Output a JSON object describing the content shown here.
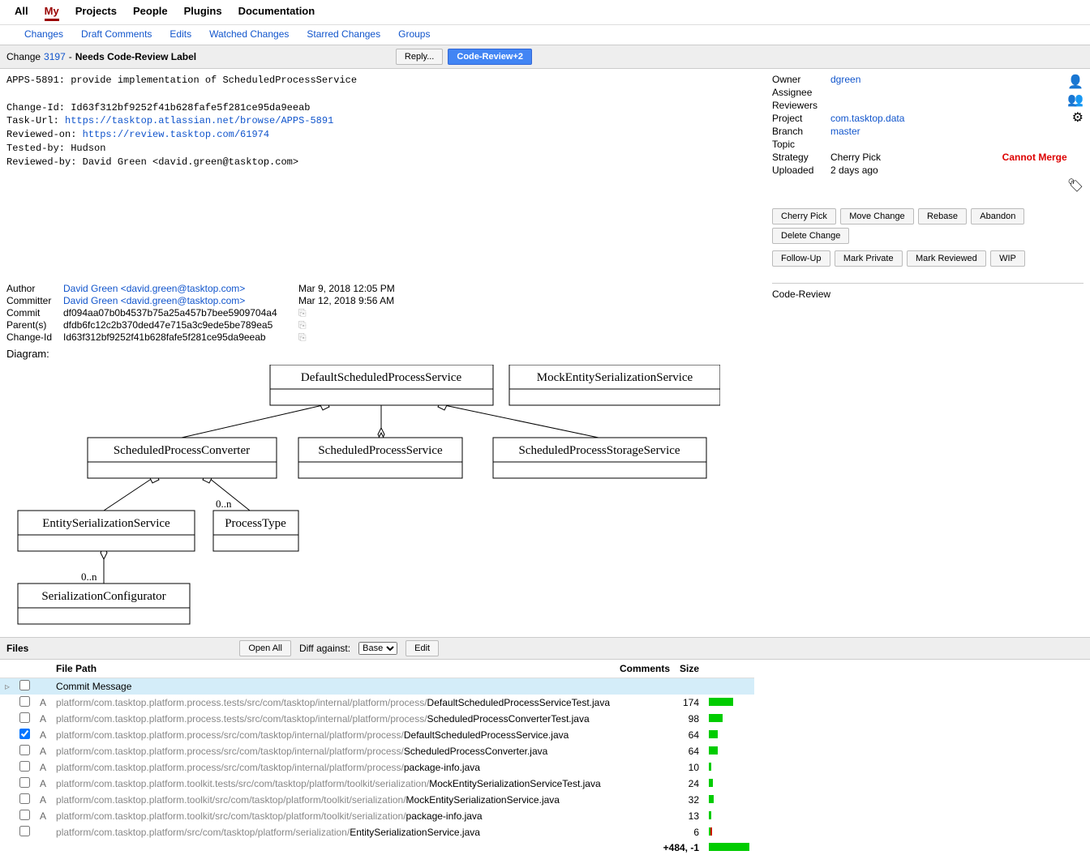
{
  "topnav": [
    "All",
    "My",
    "Projects",
    "People",
    "Plugins",
    "Documentation"
  ],
  "topnav_active": 1,
  "subnav": [
    "Changes",
    "Draft Comments",
    "Edits",
    "Watched Changes",
    "Starred Changes",
    "Groups"
  ],
  "change_header": {
    "prefix": "Change",
    "number": "3197",
    "sep": "-",
    "status": "Needs Code-Review Label",
    "reply": "Reply...",
    "code_review": "Code-Review+2"
  },
  "commit_msg": {
    "title": "APPS-5891: provide implementation of ScheduledProcessService",
    "change_id_label": "Change-Id:",
    "change_id": "Id63f312bf9252f41b628fafe5f281ce95da9eeab",
    "task_url_label": "Task-Url:",
    "task_url": "https://tasktop.atlassian.net/browse/APPS-5891",
    "reviewed_on_label": "Reviewed-on:",
    "reviewed_on": "https://review.tasktop.com/61974",
    "tested_by": "Tested-by: Hudson",
    "reviewed_by": "Reviewed-by: David Green <david.green@tasktop.com>"
  },
  "meta": {
    "author_label": "Author",
    "author": "David Green <david.green@tasktop.com>",
    "author_date": "Mar 9, 2018 12:05 PM",
    "committer_label": "Committer",
    "committer": "David Green <david.green@tasktop.com>",
    "committer_date": "Mar 12, 2018 9:56 AM",
    "commit_label": "Commit",
    "commit": "df094aa07b0b4537b75a25a457b7bee5909704a4",
    "parents_label": "Parent(s)",
    "parents": "dfdb6fc12c2b370ded47e715a3c9ede5be789ea5",
    "changeid_label": "Change-Id",
    "changeid": "Id63f312bf9252f41b628fafe5f281ce95da9eeab"
  },
  "sidebar": {
    "owner_label": "Owner",
    "owner": "dgreen",
    "assignee_label": "Assignee",
    "reviewers_label": "Reviewers",
    "project_label": "Project",
    "project": "com.tasktop.data",
    "branch_label": "Branch",
    "branch": "master",
    "topic_label": "Topic",
    "strategy_label": "Strategy",
    "strategy": "Cherry Pick",
    "cannot_merge": "Cannot Merge",
    "uploaded_label": "Uploaded",
    "uploaded": "2 days ago"
  },
  "actions": {
    "row1": [
      "Cherry Pick",
      "Move Change",
      "Rebase",
      "Abandon",
      "Delete Change"
    ],
    "row2": [
      "Follow-Up",
      "Mark Private",
      "Mark Reviewed",
      "WIP"
    ]
  },
  "review_label": "Code-Review",
  "diagram_label": "Diagram:",
  "diagram": {
    "classes": {
      "default_sps": "DefaultScheduledProcessService",
      "mock_ess": "MockEntitySerializationService",
      "spc": "ScheduledProcessConverter",
      "sps": "ScheduledProcessService",
      "spss": "ScheduledProcessStorageService",
      "ess": "EntitySerializationService",
      "pt": "ProcessType",
      "sc": "SerializationConfigurator"
    },
    "mult1": "0..n",
    "mult2": "0..n"
  },
  "files_section": {
    "title": "Files",
    "open_all": "Open All",
    "diff_against": "Diff against:",
    "base": "Base",
    "edit": "Edit"
  },
  "files_headers": {
    "path": "File Path",
    "comments": "Comments",
    "size": "Size"
  },
  "files": [
    {
      "expand": "▹",
      "checked": false,
      "status": "",
      "gray": "",
      "name": "Commit Message",
      "size": "",
      "bar": 0,
      "highlight": true
    },
    {
      "expand": "",
      "checked": false,
      "status": "A",
      "gray": "platform/com.tasktop.platform.process.tests/src/com/tasktop/internal/platform/process/",
      "name": "DefaultScheduledProcessServiceTest.java",
      "size": "174",
      "bar": 30
    },
    {
      "expand": "",
      "checked": false,
      "status": "A",
      "gray": "platform/com.tasktop.platform.process.tests/src/com/tasktop/internal/platform/process/",
      "name": "ScheduledProcessConverterTest.java",
      "size": "98",
      "bar": 17
    },
    {
      "expand": "",
      "checked": true,
      "status": "A",
      "gray": "platform/com.tasktop.platform.process/src/com/tasktop/internal/platform/process/",
      "name": "DefaultScheduledProcessService.java",
      "size": "64",
      "bar": 11
    },
    {
      "expand": "",
      "checked": false,
      "status": "A",
      "gray": "platform/com.tasktop.platform.process/src/com/tasktop/internal/platform/process/",
      "name": "ScheduledProcessConverter.java",
      "size": "64",
      "bar": 11
    },
    {
      "expand": "",
      "checked": false,
      "status": "A",
      "gray": "platform/com.tasktop.platform.process/src/com/tasktop/internal/platform/process/",
      "name": "package-info.java",
      "size": "10",
      "bar": 3
    },
    {
      "expand": "",
      "checked": false,
      "status": "A",
      "gray": "platform/com.tasktop.platform.toolkit.tests/src/com/tasktop/platform/toolkit/serialization/",
      "name": "MockEntitySerializationServiceTest.java",
      "size": "24",
      "bar": 5
    },
    {
      "expand": "",
      "checked": false,
      "status": "A",
      "gray": "platform/com.tasktop.platform.toolkit/src/com/tasktop/platform/toolkit/serialization/",
      "name": "MockEntitySerializationService.java",
      "size": "32",
      "bar": 6
    },
    {
      "expand": "",
      "checked": false,
      "status": "A",
      "gray": "platform/com.tasktop.platform.toolkit/src/com/tasktop/platform/toolkit/serialization/",
      "name": "package-info.java",
      "size": "13",
      "bar": 3
    },
    {
      "expand": "",
      "checked": false,
      "status": "",
      "gray": "platform/com.tasktop.platform/src/com/tasktop/platform/serialization/",
      "name": "EntitySerializationService.java",
      "size": "6",
      "bar": 2,
      "red": true
    }
  ],
  "totals": "+484, -1"
}
